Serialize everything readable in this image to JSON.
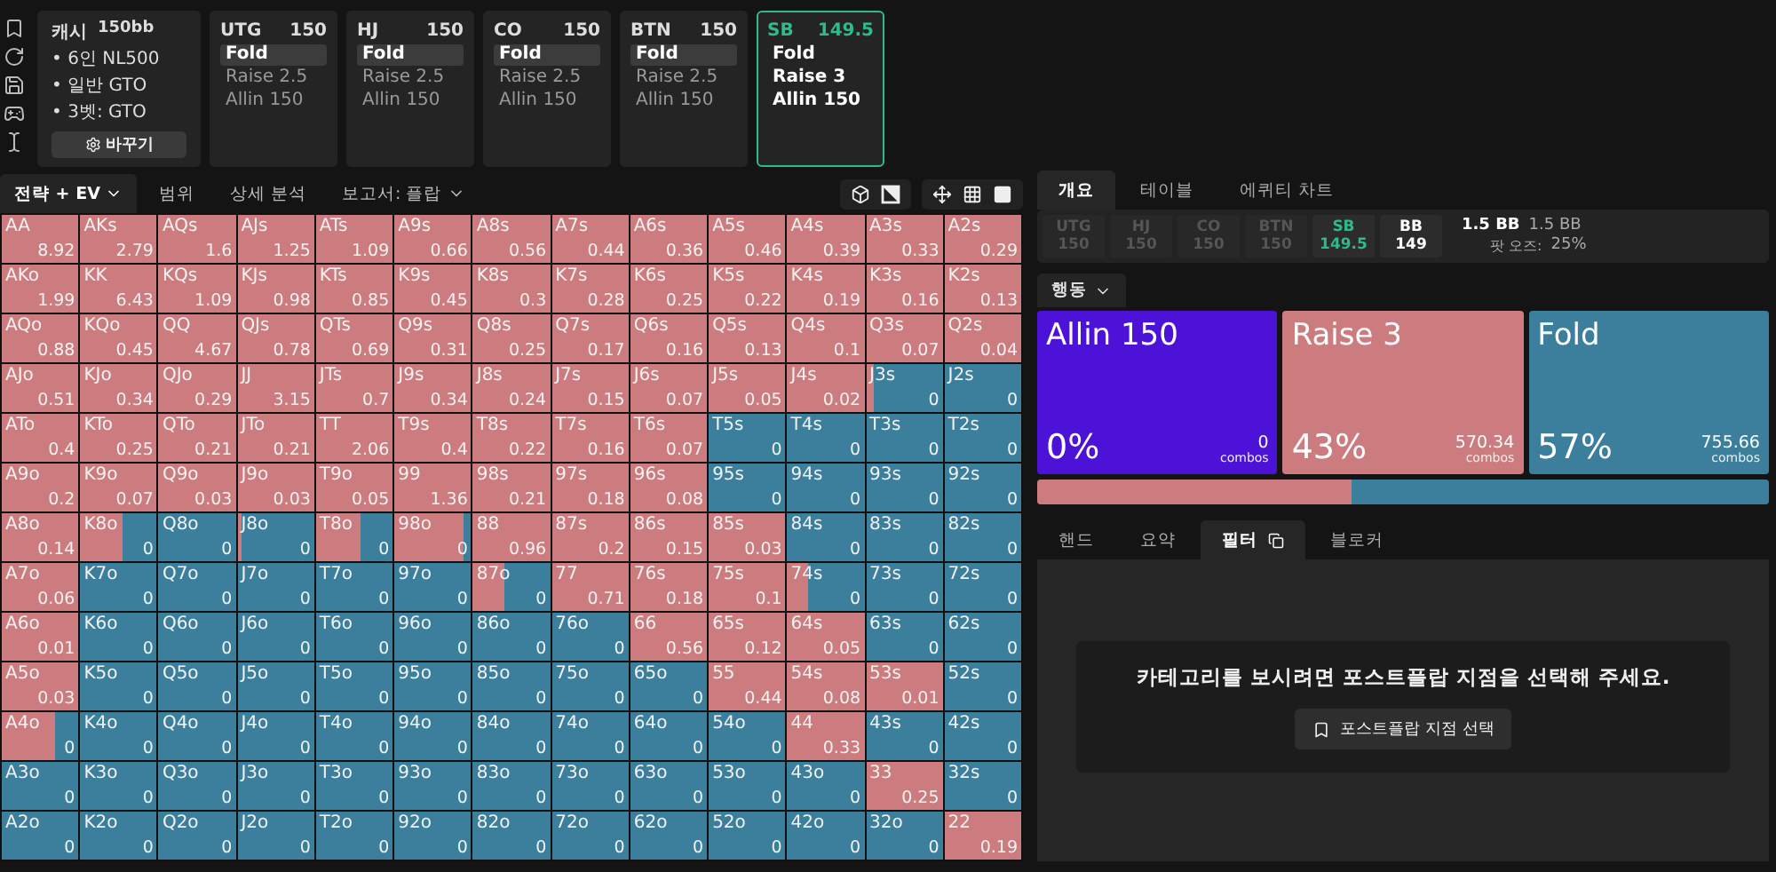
{
  "scenario": {
    "game": "캐시",
    "stack": "150bb",
    "items": [
      "• 6인 NL500",
      "• 일반 GTO",
      "• 3벳: GTO"
    ],
    "button": "바꾸기"
  },
  "positions": [
    {
      "name": "UTG",
      "stack": "150",
      "active": false,
      "actions": [
        {
          "label": "Fold",
          "selected": true
        },
        {
          "label": "Raise 2.5",
          "selected": false
        },
        {
          "label": "Allin 150",
          "selected": false
        }
      ]
    },
    {
      "name": "HJ",
      "stack": "150",
      "active": false,
      "actions": [
        {
          "label": "Fold",
          "selected": true
        },
        {
          "label": "Raise 2.5",
          "selected": false
        },
        {
          "label": "Allin 150",
          "selected": false
        }
      ]
    },
    {
      "name": "CO",
      "stack": "150",
      "active": false,
      "actions": [
        {
          "label": "Fold",
          "selected": true
        },
        {
          "label": "Raise 2.5",
          "selected": false
        },
        {
          "label": "Allin 150",
          "selected": false
        }
      ]
    },
    {
      "name": "BTN",
      "stack": "150",
      "active": false,
      "actions": [
        {
          "label": "Fold",
          "selected": true
        },
        {
          "label": "Raise 2.5",
          "selected": false
        },
        {
          "label": "Allin 150",
          "selected": false
        }
      ]
    },
    {
      "name": "SB",
      "stack": "149.5",
      "active": true,
      "actions": [
        {
          "label": "Fold",
          "selected": false
        },
        {
          "label": "Raise 3",
          "selected": false
        },
        {
          "label": "Allin 150",
          "selected": false
        }
      ]
    }
  ],
  "view_tabs": [
    {
      "label": "전략 + EV",
      "selected": true,
      "dropdown": true
    },
    {
      "label": "범위",
      "selected": false,
      "dropdown": false
    },
    {
      "label": "상세 분석",
      "selected": false,
      "dropdown": false
    },
    {
      "label": "보고서: 플랍",
      "selected": false,
      "dropdown": true
    }
  ],
  "grid": [
    [
      {
        "hand": "AA",
        "ev": "8.92",
        "level": 1
      },
      {
        "hand": "AKs",
        "ev": "2.79",
        "level": 1
      },
      {
        "hand": "AQs",
        "ev": "1.6",
        "level": 1
      },
      {
        "hand": "AJs",
        "ev": "1.25",
        "level": 1
      },
      {
        "hand": "ATs",
        "ev": "1.09",
        "level": 1
      },
      {
        "hand": "A9s",
        "ev": "0.66",
        "level": 1
      },
      {
        "hand": "A8s",
        "ev": "0.56",
        "level": 1
      },
      {
        "hand": "A7s",
        "ev": "0.44",
        "level": 1
      },
      {
        "hand": "A6s",
        "ev": "0.36",
        "level": 1
      },
      {
        "hand": "A5s",
        "ev": "0.46",
        "level": 1
      },
      {
        "hand": "A4s",
        "ev": "0.39",
        "level": 1
      },
      {
        "hand": "A3s",
        "ev": "0.33",
        "level": 1
      },
      {
        "hand": "A2s",
        "ev": "0.29",
        "level": 1
      }
    ],
    [
      {
        "hand": "AKo",
        "ev": "1.99",
        "level": 1
      },
      {
        "hand": "KK",
        "ev": "6.43",
        "level": 1
      },
      {
        "hand": "KQs",
        "ev": "1.09",
        "level": 1
      },
      {
        "hand": "KJs",
        "ev": "0.98",
        "level": 1
      },
      {
        "hand": "KTs",
        "ev": "0.85",
        "level": 1
      },
      {
        "hand": "K9s",
        "ev": "0.45",
        "level": 1
      },
      {
        "hand": "K8s",
        "ev": "0.3",
        "level": 1
      },
      {
        "hand": "K7s",
        "ev": "0.28",
        "level": 1
      },
      {
        "hand": "K6s",
        "ev": "0.25",
        "level": 1
      },
      {
        "hand": "K5s",
        "ev": "0.22",
        "level": 1
      },
      {
        "hand": "K4s",
        "ev": "0.19",
        "level": 1
      },
      {
        "hand": "K3s",
        "ev": "0.16",
        "level": 1
      },
      {
        "hand": "K2s",
        "ev": "0.13",
        "level": 1
      }
    ],
    [
      {
        "hand": "AQo",
        "ev": "0.88",
        "level": 1
      },
      {
        "hand": "KQo",
        "ev": "0.45",
        "level": 1
      },
      {
        "hand": "QQ",
        "ev": "4.67",
        "level": 1
      },
      {
        "hand": "QJs",
        "ev": "0.78",
        "level": 1
      },
      {
        "hand": "QTs",
        "ev": "0.69",
        "level": 1
      },
      {
        "hand": "Q9s",
        "ev": "0.31",
        "level": 1
      },
      {
        "hand": "Q8s",
        "ev": "0.25",
        "level": 1
      },
      {
        "hand": "Q7s",
        "ev": "0.17",
        "level": 1
      },
      {
        "hand": "Q6s",
        "ev": "0.16",
        "level": 1
      },
      {
        "hand": "Q5s",
        "ev": "0.13",
        "level": 1
      },
      {
        "hand": "Q4s",
        "ev": "0.1",
        "level": 1
      },
      {
        "hand": "Q3s",
        "ev": "0.07",
        "level": 1
      },
      {
        "hand": "Q2s",
        "ev": "0.04",
        "level": 1
      }
    ],
    [
      {
        "hand": "AJo",
        "ev": "0.51",
        "level": 1
      },
      {
        "hand": "KJo",
        "ev": "0.34",
        "level": 1
      },
      {
        "hand": "QJo",
        "ev": "0.29",
        "level": 1
      },
      {
        "hand": "JJ",
        "ev": "3.15",
        "level": 1
      },
      {
        "hand": "JTs",
        "ev": "0.7",
        "level": 1
      },
      {
        "hand": "J9s",
        "ev": "0.34",
        "level": 1
      },
      {
        "hand": "J8s",
        "ev": "0.24",
        "level": 1
      },
      {
        "hand": "J7s",
        "ev": "0.15",
        "level": 1
      },
      {
        "hand": "J6s",
        "ev": "0.07",
        "level": 1
      },
      {
        "hand": "J5s",
        "ev": "0.05",
        "level": 1
      },
      {
        "hand": "J4s",
        "ev": "0.02",
        "level": 1
      },
      {
        "hand": "J3s",
        "ev": "0",
        "level": 0.1
      },
      {
        "hand": "J2s",
        "ev": "0",
        "level": 0
      }
    ],
    [
      {
        "hand": "ATo",
        "ev": "0.4",
        "level": 1
      },
      {
        "hand": "KTo",
        "ev": "0.25",
        "level": 1
      },
      {
        "hand": "QTo",
        "ev": "0.21",
        "level": 1
      },
      {
        "hand": "JTo",
        "ev": "0.21",
        "level": 1
      },
      {
        "hand": "TT",
        "ev": "2.06",
        "level": 1
      },
      {
        "hand": "T9s",
        "ev": "0.4",
        "level": 1
      },
      {
        "hand": "T8s",
        "ev": "0.22",
        "level": 1
      },
      {
        "hand": "T7s",
        "ev": "0.16",
        "level": 1
      },
      {
        "hand": "T6s",
        "ev": "0.07",
        "level": 1
      },
      {
        "hand": "T5s",
        "ev": "0",
        "level": 0
      },
      {
        "hand": "T4s",
        "ev": "0",
        "level": 0
      },
      {
        "hand": "T3s",
        "ev": "0",
        "level": 0
      },
      {
        "hand": "T2s",
        "ev": "0",
        "level": 0
      }
    ],
    [
      {
        "hand": "A9o",
        "ev": "0.2",
        "level": 1
      },
      {
        "hand": "K9o",
        "ev": "0.07",
        "level": 1
      },
      {
        "hand": "Q9o",
        "ev": "0.03",
        "level": 1
      },
      {
        "hand": "J9o",
        "ev": "0.03",
        "level": 1
      },
      {
        "hand": "T9o",
        "ev": "0.05",
        "level": 1
      },
      {
        "hand": "99",
        "ev": "1.36",
        "level": 1
      },
      {
        "hand": "98s",
        "ev": "0.21",
        "level": 1
      },
      {
        "hand": "97s",
        "ev": "0.18",
        "level": 1
      },
      {
        "hand": "96s",
        "ev": "0.08",
        "level": 1
      },
      {
        "hand": "95s",
        "ev": "0",
        "level": 0
      },
      {
        "hand": "94s",
        "ev": "0",
        "level": 0
      },
      {
        "hand": "93s",
        "ev": "0",
        "level": 0
      },
      {
        "hand": "92s",
        "ev": "0",
        "level": 0
      }
    ],
    [
      {
        "hand": "A8o",
        "ev": "0.14",
        "level": 1
      },
      {
        "hand": "K8o",
        "ev": "0",
        "level": 0.55
      },
      {
        "hand": "Q8o",
        "ev": "0",
        "level": 0
      },
      {
        "hand": "J8o",
        "ev": "0",
        "level": 0.05
      },
      {
        "hand": "T8o",
        "ev": "0",
        "level": 0.58
      },
      {
        "hand": "98o",
        "ev": "0",
        "level": 0.9
      },
      {
        "hand": "88",
        "ev": "0.96",
        "level": 1
      },
      {
        "hand": "87s",
        "ev": "0.2",
        "level": 1
      },
      {
        "hand": "86s",
        "ev": "0.15",
        "level": 1
      },
      {
        "hand": "85s",
        "ev": "0.03",
        "level": 1
      },
      {
        "hand": "84s",
        "ev": "0",
        "level": 0
      },
      {
        "hand": "83s",
        "ev": "0",
        "level": 0
      },
      {
        "hand": "82s",
        "ev": "0",
        "level": 0
      }
    ],
    [
      {
        "hand": "A7o",
        "ev": "0.06",
        "level": 1
      },
      {
        "hand": "K7o",
        "ev": "0",
        "level": 0
      },
      {
        "hand": "Q7o",
        "ev": "0",
        "level": 0
      },
      {
        "hand": "J7o",
        "ev": "0",
        "level": 0
      },
      {
        "hand": "T7o",
        "ev": "0",
        "level": 0
      },
      {
        "hand": "97o",
        "ev": "0",
        "level": 0
      },
      {
        "hand": "87o",
        "ev": "0",
        "level": 0.4
      },
      {
        "hand": "77",
        "ev": "0.71",
        "level": 1
      },
      {
        "hand": "76s",
        "ev": "0.18",
        "level": 1
      },
      {
        "hand": "75s",
        "ev": "0.1",
        "level": 1
      },
      {
        "hand": "74s",
        "ev": "0",
        "level": 0.27
      },
      {
        "hand": "73s",
        "ev": "0",
        "level": 0
      },
      {
        "hand": "72s",
        "ev": "0",
        "level": 0
      }
    ],
    [
      {
        "hand": "A6o",
        "ev": "0.01",
        "level": 1
      },
      {
        "hand": "K6o",
        "ev": "0",
        "level": 0
      },
      {
        "hand": "Q6o",
        "ev": "0",
        "level": 0
      },
      {
        "hand": "J6o",
        "ev": "0",
        "level": 0
      },
      {
        "hand": "T6o",
        "ev": "0",
        "level": 0
      },
      {
        "hand": "96o",
        "ev": "0",
        "level": 0
      },
      {
        "hand": "86o",
        "ev": "0",
        "level": 0
      },
      {
        "hand": "76o",
        "ev": "0",
        "level": 0
      },
      {
        "hand": "66",
        "ev": "0.56",
        "level": 1
      },
      {
        "hand": "65s",
        "ev": "0.12",
        "level": 1
      },
      {
        "hand": "64s",
        "ev": "0.05",
        "level": 1
      },
      {
        "hand": "63s",
        "ev": "0",
        "level": 0
      },
      {
        "hand": "62s",
        "ev": "0",
        "level": 0
      }
    ],
    [
      {
        "hand": "A5o",
        "ev": "0.03",
        "level": 1
      },
      {
        "hand": "K5o",
        "ev": "0",
        "level": 0
      },
      {
        "hand": "Q5o",
        "ev": "0",
        "level": 0
      },
      {
        "hand": "J5o",
        "ev": "0",
        "level": 0
      },
      {
        "hand": "T5o",
        "ev": "0",
        "level": 0
      },
      {
        "hand": "95o",
        "ev": "0",
        "level": 0
      },
      {
        "hand": "85o",
        "ev": "0",
        "level": 0
      },
      {
        "hand": "75o",
        "ev": "0",
        "level": 0
      },
      {
        "hand": "65o",
        "ev": "0",
        "level": 0
      },
      {
        "hand": "55",
        "ev": "0.44",
        "level": 1
      },
      {
        "hand": "54s",
        "ev": "0.08",
        "level": 1
      },
      {
        "hand": "53s",
        "ev": "0.01",
        "level": 1
      },
      {
        "hand": "52s",
        "ev": "0",
        "level": 0
      }
    ],
    [
      {
        "hand": "A4o",
        "ev": "0",
        "level": 0.7
      },
      {
        "hand": "K4o",
        "ev": "0",
        "level": 0
      },
      {
        "hand": "Q4o",
        "ev": "0",
        "level": 0
      },
      {
        "hand": "J4o",
        "ev": "0",
        "level": 0
      },
      {
        "hand": "T4o",
        "ev": "0",
        "level": 0
      },
      {
        "hand": "94o",
        "ev": "0",
        "level": 0
      },
      {
        "hand": "84o",
        "ev": "0",
        "level": 0
      },
      {
        "hand": "74o",
        "ev": "0",
        "level": 0
      },
      {
        "hand": "64o",
        "ev": "0",
        "level": 0
      },
      {
        "hand": "54o",
        "ev": "0",
        "level": 0
      },
      {
        "hand": "44",
        "ev": "0.33",
        "level": 1
      },
      {
        "hand": "43s",
        "ev": "0",
        "level": 0
      },
      {
        "hand": "42s",
        "ev": "0",
        "level": 0
      }
    ],
    [
      {
        "hand": "A3o",
        "ev": "0",
        "level": 0
      },
      {
        "hand": "K3o",
        "ev": "0",
        "level": 0
      },
      {
        "hand": "Q3o",
        "ev": "0",
        "level": 0
      },
      {
        "hand": "J3o",
        "ev": "0",
        "level": 0
      },
      {
        "hand": "T3o",
        "ev": "0",
        "level": 0
      },
      {
        "hand": "93o",
        "ev": "0",
        "level": 0
      },
      {
        "hand": "83o",
        "ev": "0",
        "level": 0
      },
      {
        "hand": "73o",
        "ev": "0",
        "level": 0
      },
      {
        "hand": "63o",
        "ev": "0",
        "level": 0
      },
      {
        "hand": "53o",
        "ev": "0",
        "level": 0
      },
      {
        "hand": "43o",
        "ev": "0",
        "level": 0
      },
      {
        "hand": "33",
        "ev": "0.25",
        "level": 1
      },
      {
        "hand": "32s",
        "ev": "0",
        "level": 0
      }
    ],
    [
      {
        "hand": "A2o",
        "ev": "0",
        "level": 0
      },
      {
        "hand": "K2o",
        "ev": "0",
        "level": 0
      },
      {
        "hand": "Q2o",
        "ev": "0",
        "level": 0
      },
      {
        "hand": "J2o",
        "ev": "0",
        "level": 0
      },
      {
        "hand": "T2o",
        "ev": "0",
        "level": 0
      },
      {
        "hand": "92o",
        "ev": "0",
        "level": 0
      },
      {
        "hand": "82o",
        "ev": "0",
        "level": 0
      },
      {
        "hand": "72o",
        "ev": "0",
        "level": 0
      },
      {
        "hand": "62o",
        "ev": "0",
        "level": 0
      },
      {
        "hand": "52o",
        "ev": "0",
        "level": 0
      },
      {
        "hand": "42o",
        "ev": "0",
        "level": 0
      },
      {
        "hand": "32o",
        "ev": "0",
        "level": 0
      },
      {
        "hand": "22",
        "ev": "0.19",
        "level": 1
      }
    ]
  ],
  "panel_tabs": [
    {
      "label": "개요",
      "selected": true
    },
    {
      "label": "테이블",
      "selected": false
    },
    {
      "label": "에퀴티 차트",
      "selected": false
    }
  ],
  "players": [
    {
      "name": "UTG",
      "stack": "150",
      "folded": true,
      "acting": false
    },
    {
      "name": "HJ",
      "stack": "150",
      "folded": true,
      "acting": false
    },
    {
      "name": "CO",
      "stack": "150",
      "folded": true,
      "acting": false
    },
    {
      "name": "BTN",
      "stack": "150",
      "folded": true,
      "acting": false
    },
    {
      "name": "SB",
      "stack": "149.5",
      "folded": false,
      "acting": true
    },
    {
      "name": "BB",
      "stack": "149",
      "folded": false,
      "acting": false
    }
  ],
  "pot": {
    "total": "1.5 BB",
    "bet": "1.5 BB",
    "odds_label": "팟 오즈:",
    "odds": "25%"
  },
  "actions_menu": {
    "label": "행동"
  },
  "actions": [
    {
      "label": "Allin 150",
      "percent": "0%",
      "combos": "0",
      "unit": "combos",
      "color": "#4c12d8"
    },
    {
      "label": "Raise 3",
      "percent": "43%",
      "combos": "570.34",
      "unit": "combos",
      "color": "#cc7b7e"
    },
    {
      "label": "Fold",
      "percent": "57%",
      "combos": "755.66",
      "unit": "combos",
      "color": "#3b7f9c"
    }
  ],
  "strategy_bar": [
    {
      "level": 0.43,
      "color": "#cc7b7e"
    },
    {
      "level": 0.57,
      "color": "#3b7f9c"
    }
  ],
  "detail_tabs": [
    {
      "label": "핸드",
      "selected": false,
      "icon": false
    },
    {
      "label": "요약",
      "selected": false,
      "icon": false
    },
    {
      "label": "필터",
      "selected": true,
      "icon": true
    },
    {
      "label": "블로커",
      "selected": false,
      "icon": false
    }
  ],
  "filter_panel": {
    "message": "카테고리를 보시려면 포스트플랍 지점을 선택해 주세요.",
    "button": "포스트플랍 지점 선택"
  }
}
